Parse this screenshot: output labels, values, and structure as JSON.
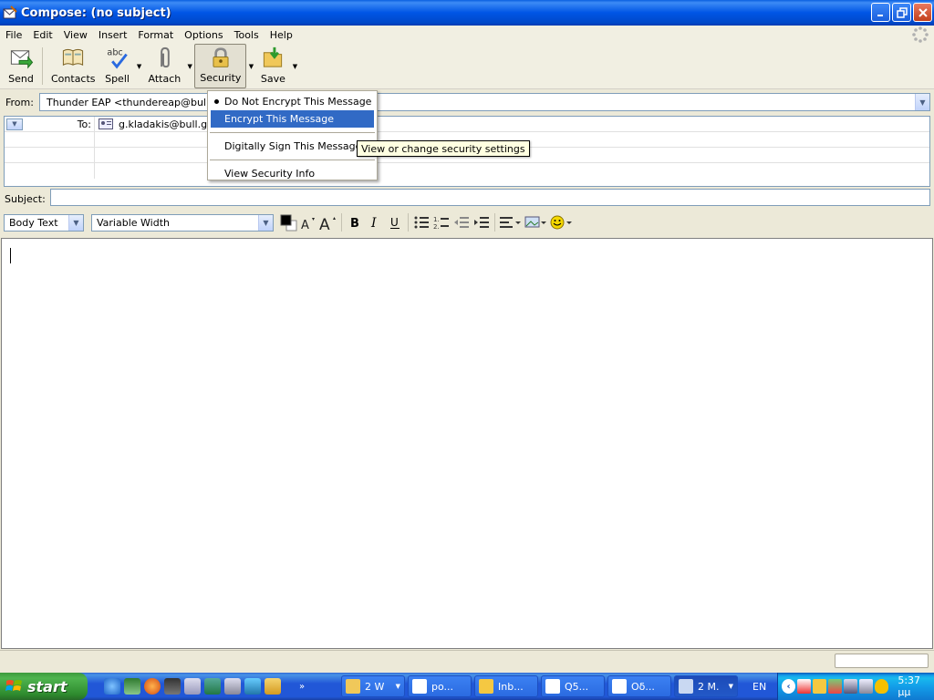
{
  "window": {
    "title": "Compose: (no subject)"
  },
  "menubar": {
    "items": [
      "File",
      "Edit",
      "View",
      "Insert",
      "Format",
      "Options",
      "Tools",
      "Help"
    ]
  },
  "toolbar": {
    "send": "Send",
    "contacts": "Contacts",
    "spell": "Spell",
    "attach": "Attach",
    "security": "Security",
    "save": "Save"
  },
  "header": {
    "from_label": "From:",
    "from_value": "Thunder EAP <thundereap@bull.gr>",
    "to_type": "To:",
    "to_value": "g.kladakis@bull.gr",
    "subject_label": "Subject:",
    "subject_value": ""
  },
  "format_bar": {
    "paragraph_style": "Body Text",
    "font": "Variable Width"
  },
  "security_menu": {
    "items": [
      {
        "label": "Do Not Encrypt This Message",
        "checked": true
      },
      {
        "label": "Encrypt This Message",
        "highlighted": true
      },
      {
        "label": "Digitally Sign This Message"
      },
      {
        "label": "View Security Info"
      }
    ]
  },
  "tooltip": {
    "text": "View or change security settings"
  },
  "taskbar": {
    "start": "start",
    "language": "EN",
    "clock": "5:37 μμ",
    "more": "»",
    "tasks": [
      {
        "label": "2 W",
        "icon_color": "#f0c85a"
      },
      {
        "label": "po...",
        "icon_color": "#ffffff"
      },
      {
        "label": "Inb...",
        "icon_color": "#f5c842"
      },
      {
        "label": "Q5...",
        "icon_color": "#ffffff"
      },
      {
        "label": "Οδ...",
        "icon_color": "#ffffff"
      },
      {
        "label": "2 M.",
        "icon_color": "#c9d8f2"
      }
    ]
  },
  "colors": {
    "accent": "#316ac5",
    "title_bar": "#0055e5",
    "tooltip_bg": "#ffffe1",
    "start_green": "#3c9a3c"
  }
}
